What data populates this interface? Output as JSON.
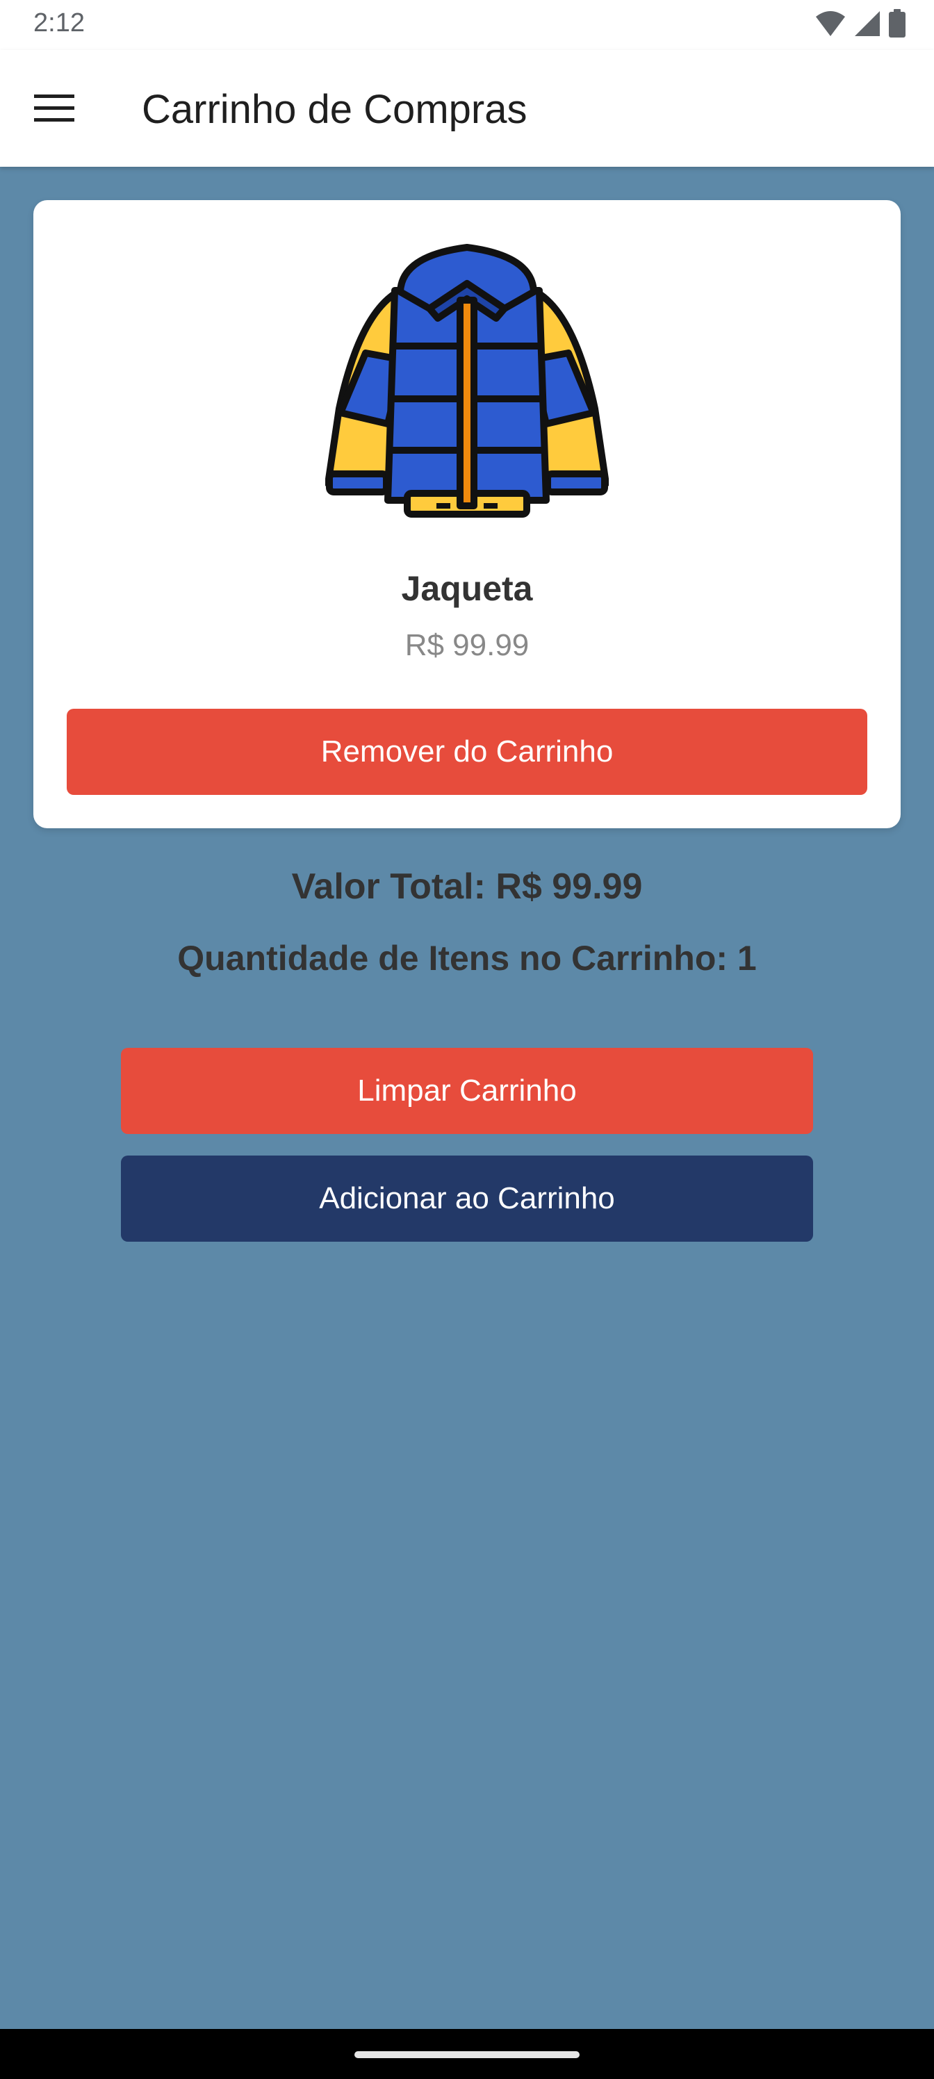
{
  "status_bar": {
    "time": "2:12",
    "icons": [
      "wifi-icon",
      "signal-icon",
      "battery-icon"
    ]
  },
  "app_bar": {
    "menu_icon": "hamburger-menu-icon",
    "title": "Carrinho de Compras"
  },
  "cart": {
    "items": [
      {
        "image_icon": "jacket-icon",
        "name": "Jaqueta",
        "price": "R$ 99.99",
        "remove_label": "Remover do Carrinho"
      }
    ],
    "total_label": "Valor Total: R$ 99.99",
    "quantity_label": "Quantidade de Itens no Carrinho: 1",
    "clear_label": "Limpar Carrinho",
    "add_label": "Adicionar ao Carrinho"
  },
  "colors": {
    "background": "#5d89a8",
    "danger": "#e74c3c",
    "primary": "#233968",
    "card": "#ffffff",
    "text": "#333333",
    "muted": "#888888"
  }
}
